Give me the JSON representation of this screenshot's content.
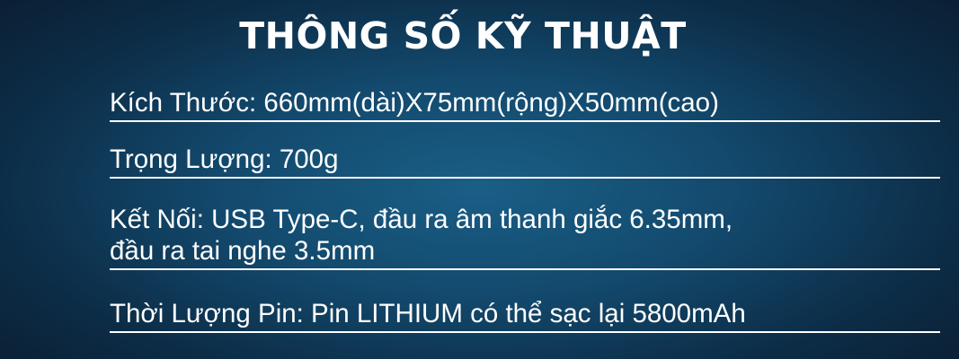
{
  "title": "THÔNG SỐ KỸ THUẬT",
  "specs": [
    {
      "lines": [
        "Kích Thước: 660mm(dài)X75mm(rộng)X50mm(cao)"
      ]
    },
    {
      "lines": [
        "Trọng Lượng: 700g"
      ]
    },
    {
      "lines": [
        "Kết Nối: USB Type-C, đầu ra âm thanh giắc 6.35mm,",
        "đầu ra tai nghe 3.5mm"
      ]
    },
    {
      "lines": [
        "Thời Lượng Pin: Pin LITHIUM có thể sạc lại 5800mAh"
      ]
    }
  ]
}
